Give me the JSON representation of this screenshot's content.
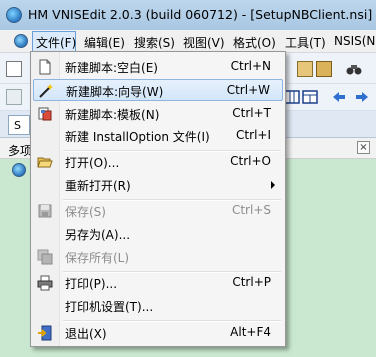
{
  "window": {
    "title": "HM VNISEdit 2.0.3 (build 060712) - [SetupNBClient.nsi]",
    "app_icon": "globe-icon"
  },
  "menubar": {
    "items": [
      "文件(F)",
      "编辑(E)",
      "搜索(S)",
      "视图(V)",
      "格式(O)",
      "工具(T)",
      "NSIS(N)"
    ]
  },
  "left_panel": {
    "tab_label": "S",
    "header": "多项",
    "close_symbol": "×"
  },
  "file_menu": {
    "items": [
      {
        "label": "新建脚本:空白(E)",
        "shortcut": "Ctrl+N",
        "icon": "new-blank-icon",
        "enabled": true
      },
      {
        "label": "新建脚本:向导(W)",
        "shortcut": "Ctrl+W",
        "icon": "wizard-wand-icon",
        "enabled": true,
        "highlighted": true
      },
      {
        "label": "新建脚本:模板(N)",
        "shortcut": "Ctrl+T",
        "icon": "template-icon",
        "enabled": true
      },
      {
        "label": "新建 InstallOption 文件(I)",
        "shortcut": "Ctrl+I",
        "icon": "",
        "enabled": true
      },
      {
        "label": "打开(O)...",
        "shortcut": "Ctrl+O",
        "icon": "open-folder-icon",
        "enabled": true
      },
      {
        "label": "重新打开(R)",
        "shortcut": "",
        "icon": "",
        "enabled": true,
        "submenu": true
      },
      {
        "label": "保存(S)",
        "shortcut": "Ctrl+S",
        "icon": "save-disk-icon",
        "enabled": false
      },
      {
        "label": "另存为(A)...",
        "shortcut": "",
        "icon": "",
        "enabled": true
      },
      {
        "label": "保存所有(L)",
        "shortcut": "",
        "icon": "save-all-icon",
        "enabled": false
      },
      {
        "label": "打印(P)...",
        "shortcut": "Ctrl+P",
        "icon": "printer-icon",
        "enabled": true
      },
      {
        "label": "打印机设置(T)...",
        "shortcut": "",
        "icon": "",
        "enabled": true
      },
      {
        "label": "退出(X)",
        "shortcut": "Alt+F4",
        "icon": "exit-door-icon",
        "enabled": true
      }
    ]
  },
  "colors": {
    "highlight_fill": "#d3e6f9",
    "highlight_border": "#8db5e0",
    "disabled_text": "#8d8d8d",
    "panel_background": "#c9e8cf"
  }
}
